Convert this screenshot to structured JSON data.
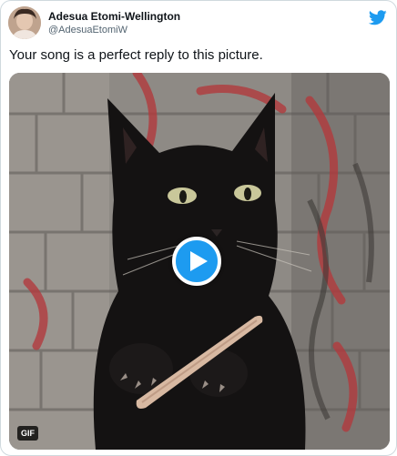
{
  "tweet": {
    "author": {
      "display_name": "Adesua Etomi-Wellington",
      "handle": "@AdesuaEtomiW",
      "avatar_icon": "profile-photo"
    },
    "text": "Your song is a perfect reply to this picture.",
    "media": {
      "type": "gif",
      "badge": "GIF",
      "play_icon": "play-icon",
      "description_icon": "cat-filing-nails-image"
    },
    "brand_icon": "twitter-bird-icon",
    "colors": {
      "accent": "#1d9bf0",
      "text": "#0f1419",
      "secondary_text": "#536471",
      "border": "#cfd9de"
    }
  }
}
